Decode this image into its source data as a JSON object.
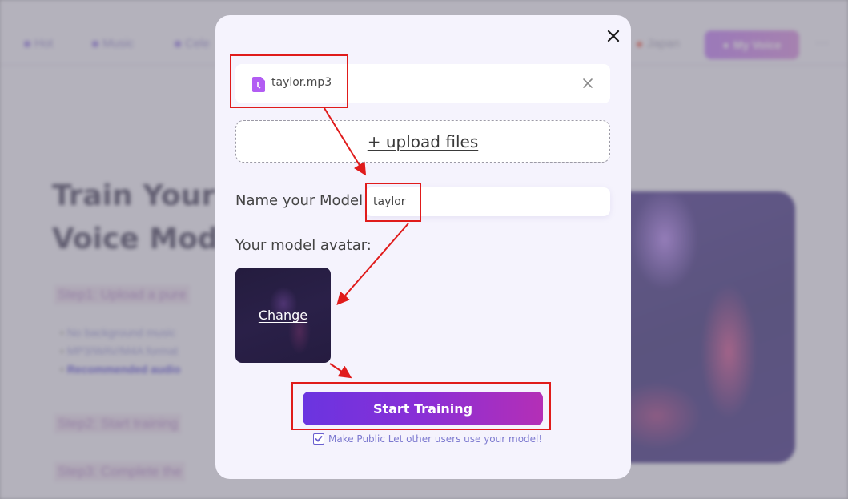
{
  "background": {
    "nav": {
      "items": [
        {
          "label": "Hot",
          "icon": "fire-icon"
        },
        {
          "label": "Music",
          "icon": "music-icon"
        },
        {
          "label": "Cele",
          "icon": "person-icon"
        },
        {
          "label": "Japan",
          "icon": "japan-flag-icon"
        }
      ],
      "my_voice_button": "My Voice",
      "more_label": "···"
    },
    "headline": [
      "Train Your C",
      "Voice Mode"
    ],
    "steps": [
      "Step1: Upload a pure",
      "Step2: Start training",
      "Step3: Complete the"
    ],
    "bullets": [
      "No background music",
      "MP3/WAV/M4A format",
      "Recommended audio"
    ]
  },
  "modal": {
    "close_icon": "close-icon",
    "file": {
      "name": "taylor.mp3",
      "icon": "audio-file-icon",
      "remove_icon": "remove-file-icon"
    },
    "upload_label": "+ upload files",
    "name_label": "Name your Model",
    "name_value": "taylor",
    "avatar_label": "Your model avatar:",
    "avatar_change_label": "Change",
    "start_button": "Start Training",
    "public_checked": true,
    "public_label": "Make Public Let other users use your model!"
  },
  "colors": {
    "accent_start": "#6a34e0",
    "accent_end": "#b42fb6",
    "annotation": "#e01b1b",
    "file_icon": "#b25cf3",
    "modal_bg": "#f5f3fd"
  }
}
